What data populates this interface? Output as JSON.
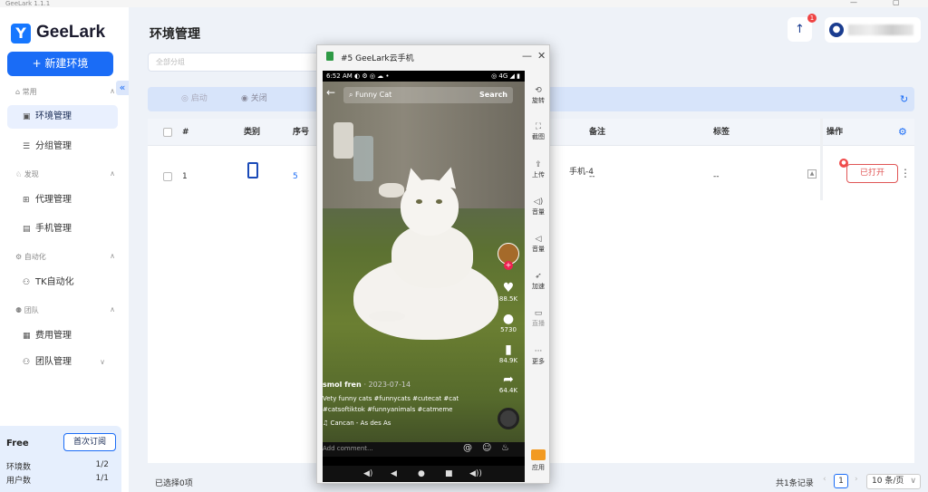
{
  "window": {
    "title": "GeeLark 1.1.1"
  },
  "sidebar": {
    "logo_text": "GeeLark",
    "new_button": "+ 新建环境",
    "groups": {
      "common": "常用",
      "discover": "发现",
      "automation": "自动化",
      "team": "团队"
    },
    "items": {
      "env": "环境管理",
      "group": "分组管理",
      "proxy": "代理管理",
      "phone": "手机管理",
      "tk": "TK自动化",
      "billing": "费用管理",
      "team": "团队管理"
    },
    "plan": {
      "name": "Free",
      "subscribe": "首次订阅",
      "env_label": "环境数",
      "env_value": "1/2",
      "user_label": "用户数",
      "user_value": "1/1"
    }
  },
  "header": {
    "title": "环境管理",
    "upload_badge": "1"
  },
  "filter": {
    "placeholder": "全部分组"
  },
  "actions": {
    "start": "启动",
    "close": "关闭"
  },
  "table": {
    "headers": {
      "index": "#",
      "type": "类别",
      "seq": "序号",
      "remark": "备注",
      "tags": "标签",
      "op": "操作"
    },
    "rows": [
      {
        "index": "1",
        "seq": "5",
        "name_tail": "手机-4",
        "remark": "--",
        "tags": "--",
        "status": "已打开"
      }
    ]
  },
  "footer": {
    "selected": "已选择0项",
    "total": "共1条记录",
    "page": "1",
    "page_size": "10 条/页"
  },
  "cloud_phone": {
    "title": "#5 GeeLark云手机",
    "statusbar_time": "6:52 AM",
    "statusbar_right": "4G",
    "search_query": "Funny Cat",
    "search_button": "Search",
    "likes": "88.5K",
    "comments": "5730",
    "saves": "84.9K",
    "shares": "64.4K",
    "author": "smol fren",
    "date": "· 2023-07-14",
    "caption_line1": "Vety funny cats #funnycats #cutecat #cat",
    "caption_line2": "#catsoftiktok #funnyanimals #catmeme",
    "music": "♫ Cancan - As des As",
    "comment_placeholder": "Add comment...",
    "tools": {
      "rotate": "旋转",
      "screenshot": "截图",
      "upload": "上传",
      "vol_up": "音量",
      "vol_down": "音量",
      "speed": "加速",
      "live": "直播",
      "more": "更多",
      "apps": "应用"
    }
  }
}
